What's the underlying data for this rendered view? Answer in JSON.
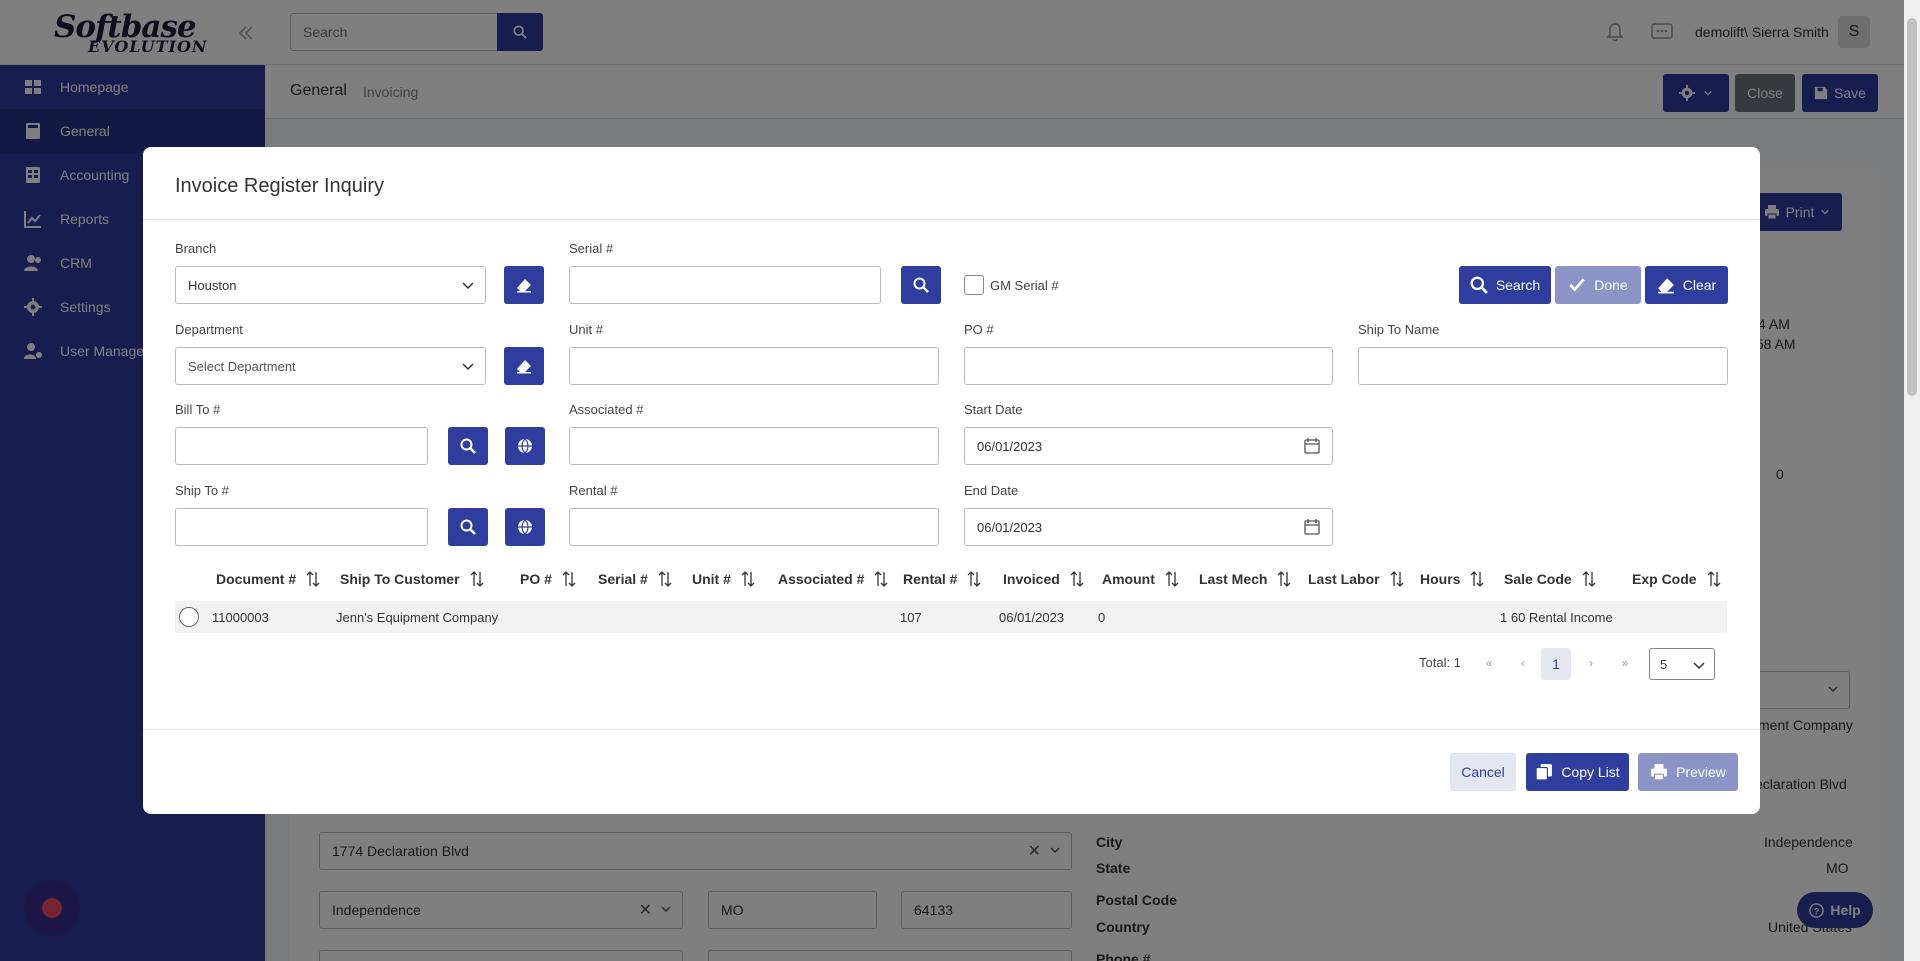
{
  "app": {
    "logo_line1": "Softbase",
    "logo_line2": "EVOLUTION"
  },
  "sidebar": {
    "items": [
      {
        "label": "Homepage",
        "icon": "dashboard-icon"
      },
      {
        "label": "General",
        "icon": "calculator-icon",
        "active": true
      },
      {
        "label": "Accounting",
        "icon": "ledger-icon"
      },
      {
        "label": "Reports",
        "icon": "chart-icon"
      },
      {
        "label": "CRM",
        "icon": "users-icon"
      },
      {
        "label": "Settings",
        "icon": "gear-icon"
      },
      {
        "label": "User Management",
        "icon": "user-gear-icon"
      }
    ]
  },
  "topbar": {
    "search_placeholder": "Search",
    "user": "demolift\\ Sierra Smith",
    "avatar_initial": "S"
  },
  "subheader": {
    "title": "General",
    "subtitle": "Invoicing",
    "close_label": "Close",
    "save_label": "Save"
  },
  "background": {
    "print_label": "Print",
    "time1": "4 AM",
    "time2": ":58 AM",
    "zero": "0",
    "company": "ment Company",
    "address_right": "eclaration Blvd",
    "address_select": "1774 Declaration Blvd",
    "city_select": "Independence",
    "state_input": "MO",
    "zip_input": "64133",
    "city_label": "City",
    "city_value": "Independence",
    "state_label": "State",
    "state_value": "MO",
    "postal_label": "Postal Code",
    "country_label": "Country",
    "country_value": "United States",
    "phone_label": "Phone #",
    "help_label": "Help"
  },
  "modal": {
    "title": "Invoice Register Inquiry",
    "fields": {
      "branch_label": "Branch",
      "branch_value": "Houston",
      "serial_label": "Serial #",
      "serial_value": "",
      "gm_serial_label": "GM Serial #",
      "department_label": "Department",
      "department_placeholder": "Select Department",
      "unit_label": "Unit #",
      "unit_value": "",
      "po_label": "PO #",
      "po_value": "",
      "ship_to_name_label": "Ship To Name",
      "ship_to_name_value": "",
      "bill_to_label": "Bill To #",
      "bill_to_value": "",
      "associated_label": "Associated #",
      "associated_value": "",
      "start_date_label": "Start Date",
      "start_date_value": "06/01/2023",
      "ship_to_label": "Ship To #",
      "ship_to_value": "",
      "rental_label": "Rental #",
      "rental_value": "",
      "end_date_label": "End Date",
      "end_date_value": "06/01/2023"
    },
    "buttons": {
      "search": "Search",
      "done": "Done",
      "clear": "Clear",
      "cancel": "Cancel",
      "copy_list": "Copy List",
      "preview": "Preview"
    },
    "table": {
      "columns": [
        "Document #",
        "Ship To Customer",
        "PO #",
        "Serial #",
        "Unit #",
        "Associated #",
        "Rental #",
        "Invoiced",
        "Amount",
        "Last Mech",
        "Last Labor",
        "Hours",
        "Sale Code",
        "Exp Code"
      ],
      "rows": [
        {
          "document": "11000003",
          "ship_to_customer": "Jenn's Equipment Company",
          "po": "",
          "serial": "",
          "unit": "",
          "associated": "",
          "rental": "107",
          "invoiced": "06/01/2023",
          "amount": "0",
          "last_mech": "",
          "last_labor": "",
          "hours": "",
          "sale_code": "1 60 Rental Income",
          "exp_code": ""
        }
      ]
    },
    "pagination": {
      "total": "Total: 1",
      "current_page": "1",
      "page_size": "5"
    }
  }
}
